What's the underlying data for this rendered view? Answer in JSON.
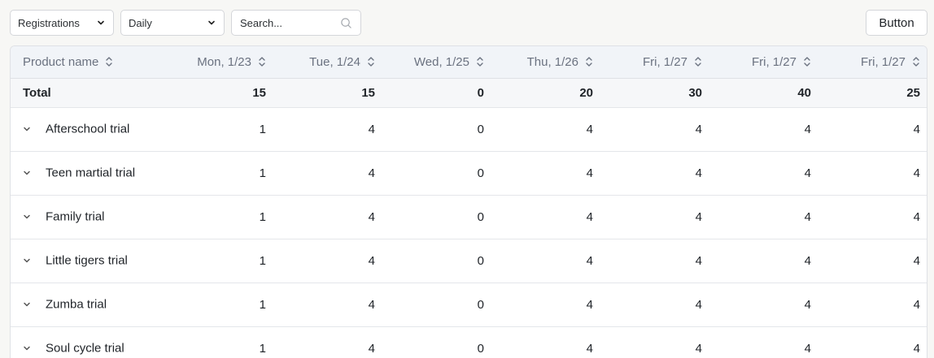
{
  "toolbar": {
    "metric_select": "Registrations",
    "period_select": "Daily",
    "search_placeholder": "Search...",
    "button_label": "Button"
  },
  "table": {
    "name_header": "Product name",
    "columns": [
      "Mon, 1/23",
      "Tue, 1/24",
      "Wed, 1/25",
      "Thu, 1/26",
      "Fri, 1/27",
      "Fri, 1/27",
      "Fri, 1/27"
    ],
    "total": {
      "label": "Total",
      "values": [
        "15",
        "15",
        "0",
        "20",
        "30",
        "40",
        "25"
      ]
    },
    "rows": [
      {
        "name": "Afterschool trial",
        "values": [
          "1",
          "4",
          "0",
          "4",
          "4",
          "4",
          "4"
        ]
      },
      {
        "name": "Teen martial trial",
        "values": [
          "1",
          "4",
          "0",
          "4",
          "4",
          "4",
          "4"
        ]
      },
      {
        "name": "Family trial",
        "values": [
          "1",
          "4",
          "0",
          "4",
          "4",
          "4",
          "4"
        ]
      },
      {
        "name": "Little tigers trial",
        "values": [
          "1",
          "4",
          "0",
          "4",
          "4",
          "4",
          "4"
        ]
      },
      {
        "name": "Zumba trial",
        "values": [
          "1",
          "4",
          "0",
          "4",
          "4",
          "4",
          "4"
        ]
      },
      {
        "name": "Soul cycle trial",
        "values": [
          "1",
          "4",
          "0",
          "4",
          "4",
          "4",
          "4"
        ]
      }
    ]
  },
  "icons": {
    "select_chevron": "chevron-down-icon",
    "search": "search-icon",
    "sort": "sort-icon",
    "row_expand": "chevron-down-icon"
  }
}
